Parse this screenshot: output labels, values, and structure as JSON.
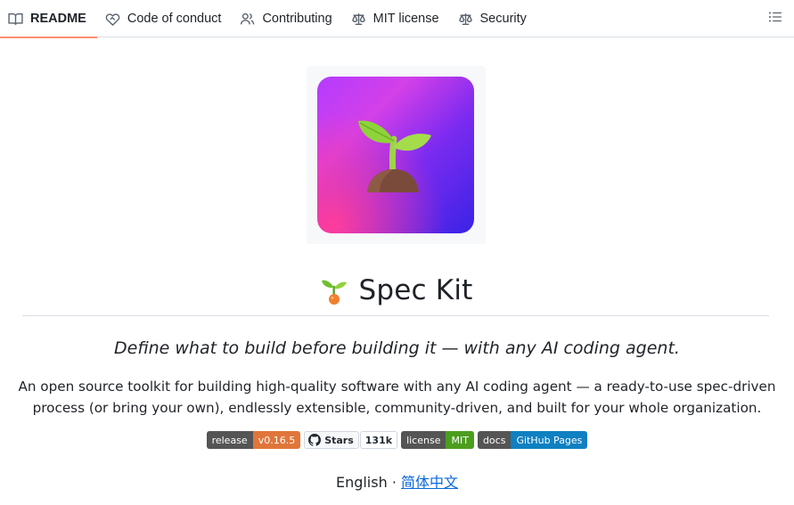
{
  "tabs": [
    {
      "label": "README",
      "icon": "book-icon",
      "active": true
    },
    {
      "label": "Code of conduct",
      "icon": "code-of-conduct-icon",
      "active": false
    },
    {
      "label": "Contributing",
      "icon": "people-icon",
      "active": false
    },
    {
      "label": "MIT license",
      "icon": "law-icon",
      "active": false
    },
    {
      "label": "Security",
      "icon": "law-icon",
      "active": false
    }
  ],
  "outline_icon": "list-unordered-icon",
  "readme": {
    "title": "Spec Kit",
    "tagline": "Define what to build before building it — with any AI coding agent.",
    "description": "An open source toolkit for building high-quality software with any AI coding agent — a ready-to-use spec-driven process (or bring your own), endlessly extensible, community-driven, and built for your whole organization.",
    "badges": {
      "release_label": "release",
      "release_value": "v0.16.5",
      "stars_label": "Stars",
      "stars_count": "131k",
      "license_label": "license",
      "license_value": "MIT",
      "docs_label": "docs",
      "docs_value": "GitHub Pages"
    },
    "languages": {
      "current": "English",
      "separator": "·",
      "other": "简体中文"
    }
  },
  "colors": {
    "accent_underline": "#fd8c73",
    "link": "#0969da",
    "badge_grey": "#555555",
    "badge_orange": "#e0763b",
    "badge_green": "#4c9e1f",
    "badge_blue": "#0f80c1"
  }
}
